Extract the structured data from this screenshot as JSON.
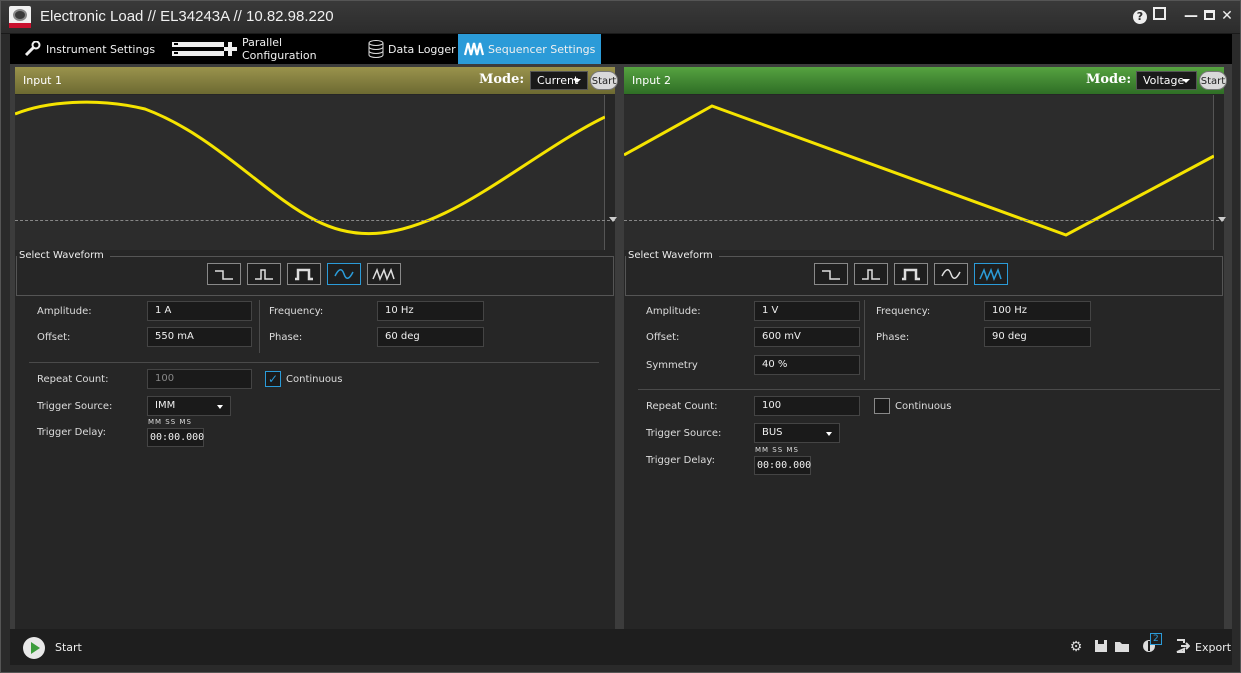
{
  "window": {
    "title": "Electronic Load // EL34243A // 10.82.98.220"
  },
  "tabs": [
    {
      "label": "Instrument Settings",
      "icon": "wrench-icon",
      "active": false
    },
    {
      "label": "Parallel Configuration",
      "icon": "parallel-icon",
      "active": false
    },
    {
      "label": "Data Logger",
      "icon": "database-icon",
      "active": false
    },
    {
      "label": "Sequencer Settings",
      "icon": "waveform-icon",
      "active": true
    }
  ],
  "colors": {
    "accent": "#2b9bd8",
    "trace": "#f5e400",
    "input1_header": "#8c8640",
    "input2_header": "#4a8f38"
  },
  "panels": [
    {
      "name": "Input 1",
      "mode_label": "Mode:",
      "mode_value": "Current",
      "start_label": "Start",
      "waveform_legend": "Select Waveform",
      "selected_waveform": "sine",
      "fields": {
        "amplitude_label": "Amplitude:",
        "amplitude": "1 A",
        "frequency_label": "Frequency:",
        "frequency": "10 Hz",
        "offset_label": "Offset:",
        "offset": "550 mA",
        "phase_label": "Phase:",
        "phase": "60 deg",
        "repeat_label": "Repeat Count:",
        "repeat": "100",
        "continuous_label": "Continuous",
        "continuous": true,
        "trigger_source_label": "Trigger Source:",
        "trigger_source": "IMM",
        "trigger_delay_label": "Trigger Delay:",
        "time_caps": "MM SS MS",
        "trigger_delay": "00:00.000"
      }
    },
    {
      "name": "Input 2",
      "mode_label": "Mode:",
      "mode_value": "Voltage",
      "start_label": "Start",
      "waveform_legend": "Select Waveform",
      "selected_waveform": "ramp",
      "fields": {
        "amplitude_label": "Amplitude:",
        "amplitude": "1 V",
        "frequency_label": "Frequency:",
        "frequency": "100 Hz",
        "offset_label": "Offset:",
        "offset": "600 mV",
        "phase_label": "Phase:",
        "phase": "90 deg",
        "symmetry_label": "Symmetry",
        "symmetry": "40 %",
        "repeat_label": "Repeat Count:",
        "repeat": "100",
        "continuous_label": "Continuous",
        "continuous": false,
        "trigger_source_label": "Trigger Source:",
        "trigger_source": "BUS",
        "trigger_delay_label": "Trigger Delay:",
        "time_caps": "MM SS MS",
        "trigger_delay": "00:00.000"
      }
    }
  ],
  "bottom": {
    "start_label": "Start",
    "icons": [
      "gear-icon",
      "save-icon",
      "folder-icon",
      "instrument-icon"
    ],
    "instrument_badge": "2",
    "export_label": "Export"
  }
}
